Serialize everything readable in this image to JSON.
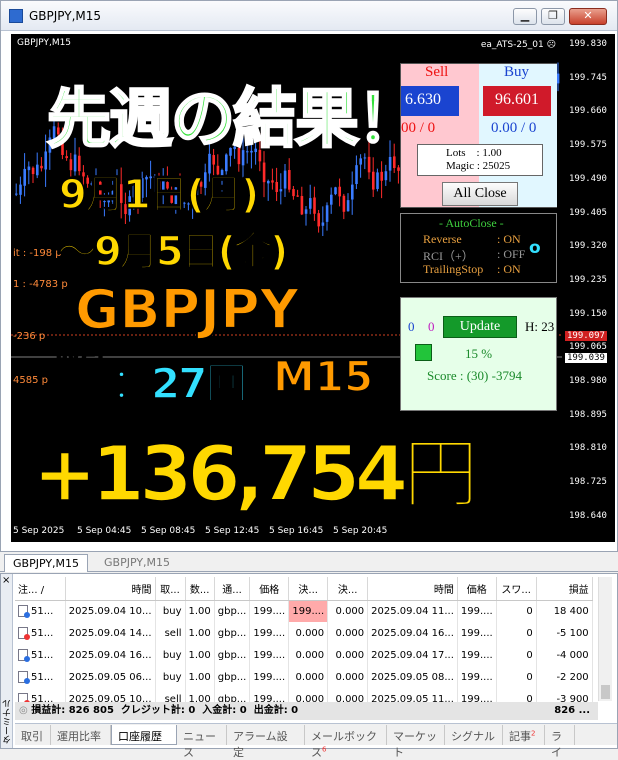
{
  "window": {
    "title": "GBPJPY,M15"
  },
  "chart": {
    "symbol_label": "GBPJPY,M15",
    "ea_name": "ea_ATS-25_01",
    "price_ticks": [
      "199.830",
      "199.745",
      "199.660",
      "199.575",
      "199.490",
      "199.405",
      "199.320",
      "199.235",
      "199.150",
      "199.065",
      "198.980",
      "198.895",
      "198.810",
      "198.725",
      "198.640"
    ],
    "bid_tag": "199.097",
    "ask_tag": "199.039",
    "time_ticks": [
      "5 Sep 2025",
      "5 Sep 04:45",
      "5 Sep 08:45",
      "5 Sep 12:45",
      "5 Sep 16:45",
      "5 Sep 20:45"
    ],
    "level_labels": [
      "it : -198 p",
      "1 : -4783 p",
      "-236 p",
      "4585 p"
    ]
  },
  "overlay": {
    "headline": "先週の結果！",
    "date_from": "9月1日(月)",
    "date_to": "〜9月5日(金)",
    "pair": "GBPJPY",
    "trades_label_1": "取引",
    "trades_label_2": "回数",
    "trades_count": "：27回",
    "timeframe": "M15",
    "profit": "+136,754円"
  },
  "ea_panel": {
    "sell_label": "Sell",
    "buy_label": "Buy",
    "sell_price": "6.630",
    "buy_price": "96.601",
    "sell_pos": "00 / 0",
    "buy_pos": "0.00 / 0",
    "lots": "Lots    : 1.00",
    "magic": "Magic : 25025",
    "all_close": "All Close",
    "autoclose_title": "- AutoClose -",
    "ac_rows": [
      {
        "k": "Reverse",
        "v": ": ON"
      },
      {
        "k": "RCI（+）",
        "v": ": OFF"
      },
      {
        "k": "TrailingStop",
        "v": ": ON"
      }
    ],
    "ac_circle": "o",
    "zero_a": "0",
    "zero_b": "0",
    "update": "Update",
    "h_value": "H: 23",
    "percent": "15 %",
    "score": "Score : (30) -3794"
  },
  "chart_tabs": [
    "GBPJPY,M15",
    "GBPJPY,M15"
  ],
  "terminal": {
    "close_glyph": "×",
    "side_label": "ターミナル",
    "columns": [
      "注... /",
      "時間",
      "取...",
      "数...",
      "通...",
      "価格",
      "決...",
      "決...",
      "時間",
      "価格",
      "スワ...",
      "損益"
    ],
    "rows": [
      {
        "icon": "blue",
        "ticket": "51...",
        "time": "2025.09.04 10...",
        "type": "buy",
        "vol": "1.00",
        "sym": "gbp...",
        "price": "199....",
        "sl": "199....",
        "tp": "0.000",
        "ctime": "2025.09.04 11...",
        "cprice": "199....",
        "swap": "0",
        "profit": "18 400"
      },
      {
        "icon": "red",
        "ticket": "51...",
        "time": "2025.09.04 14...",
        "type": "sell",
        "vol": "1.00",
        "sym": "gbp...",
        "price": "199....",
        "sl": "0.000",
        "tp": "0.000",
        "ctime": "2025.09.04 16...",
        "cprice": "199....",
        "swap": "0",
        "profit": "-5 100"
      },
      {
        "icon": "blue",
        "ticket": "51...",
        "time": "2025.09.04 16...",
        "type": "buy",
        "vol": "1.00",
        "sym": "gbp...",
        "price": "199....",
        "sl": "0.000",
        "tp": "0.000",
        "ctime": "2025.09.04 17...",
        "cprice": "199....",
        "swap": "0",
        "profit": "-4 000"
      },
      {
        "icon": "blue",
        "ticket": "51...",
        "time": "2025.09.05 06...",
        "type": "buy",
        "vol": "1.00",
        "sym": "gbp...",
        "price": "199....",
        "sl": "0.000",
        "tp": "0.000",
        "ctime": "2025.09.05 08...",
        "cprice": "199....",
        "swap": "0",
        "profit": "-2 200"
      },
      {
        "icon": "red",
        "ticket": "51...",
        "time": "2025.09.05 10...",
        "type": "sell",
        "vol": "1.00",
        "sym": "gbp...",
        "price": "199....",
        "sl": "0.000",
        "tp": "0.000",
        "ctime": "2025.09.05 11...",
        "cprice": "199....",
        "swap": "0",
        "profit": "-3 900"
      }
    ],
    "totals": "損益計: 826 805  クレジット計: 0  入金計: 0  出金計: 0",
    "totals_right": "826 ...",
    "tabs": [
      "取引",
      "運用比率",
      "口座履歴",
      "ニュース",
      "アラーム設定",
      "メールボックス",
      "マーケット",
      "シグナル",
      "記事",
      "ライ"
    ],
    "mailbox_badge": "6",
    "articles_badge": "2",
    "active_tab": 2
  }
}
